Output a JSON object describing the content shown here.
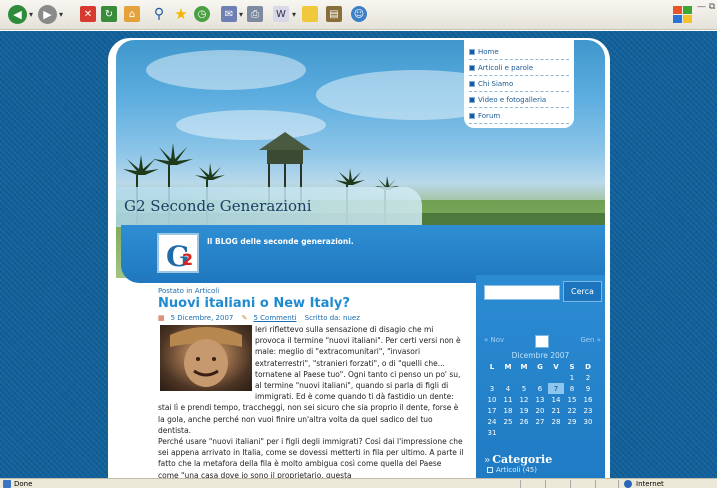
{
  "browser": {
    "toolbar_icons": [
      "back-icon",
      "forward-icon",
      "stop-icon",
      "refresh-icon",
      "home-icon",
      "search-icon",
      "favorites-icon",
      "history-icon",
      "mail-icon",
      "print-icon",
      "edit-icon",
      "folder-icon",
      "research-icon",
      "messenger-icon"
    ],
    "status_text": "Done",
    "zone_text": "Internet"
  },
  "nav": {
    "items": [
      {
        "label": "Home"
      },
      {
        "label": "Articoli e parole"
      },
      {
        "label": "Chi Siamo"
      },
      {
        "label": "Video e fotogalleria"
      },
      {
        "label": "Forum"
      }
    ]
  },
  "site": {
    "title": "G2 Seconde Generazioni",
    "tagline": "Il BLOG delle seconde generazioni.",
    "logo_letter": "G",
    "logo_number": "2"
  },
  "post": {
    "category_line": "Postato in Articoli",
    "title": "Nuovi italiani o New Italy?",
    "date": "5 Dicembre, 2007",
    "comments": "5 Commenti",
    "author": "Scritto da: nuez",
    "body_p1": "Ieri riflettevo sulla sensazione di disagio che mi provoca il termine \"nuovi italiani\". Per certi versi non è male: meglio di \"extracomunitari\", \"invasori extraterrestri\", \"stranieri forzati\", o di \"quelli che... tornatene al Paese tuo\". Ogni tanto ci penso un po' su, al termine \"nuovi italiani\", quando si parla di figli di immigrati. Ed è come quando ti dà fastidio un dente: stai lì e prendi tempo, traccheggi, non sei sicuro che sia proprio il dente, forse è la gola, anche perché non vuoi finire un'altra volta da quel sadico del tuo dentista.",
    "body_p2": "Perché usare \"nuovi italiani\" per i figli degli immigrati? Così dai l'impressione che sei appena arrivato in Italia, come se dovessi metterti in fila per ultimo. A parte il fatto che la metafora della fila è molto ambigua così come quella del Paese come \"una casa dove io sono il proprietario, questa"
  },
  "sidebar": {
    "search_button": "Cerca",
    "search_placeholder": "",
    "calendar": {
      "prev": "« Nov",
      "next": "Gen »",
      "month": "Dicembre 2007",
      "weekdays": [
        "L",
        "M",
        "M",
        "G",
        "V",
        "S",
        "D"
      ],
      "weeks": [
        [
          "",
          "",
          "",
          "",
          "",
          "1",
          "2"
        ],
        [
          "3",
          "4",
          "5",
          "6",
          "7",
          "8",
          "9"
        ],
        [
          "10",
          "11",
          "12",
          "13",
          "14",
          "15",
          "16"
        ],
        [
          "17",
          "18",
          "19",
          "20",
          "21",
          "22",
          "23"
        ],
        [
          "24",
          "25",
          "26",
          "27",
          "28",
          "29",
          "30"
        ],
        [
          "31",
          "",
          "",
          "",
          "",
          "",
          ""
        ]
      ],
      "today": "7"
    },
    "categories_heading": "Categorie",
    "category_item": "Articoli (45)"
  },
  "colors": {
    "accent": "#1f8bd1",
    "sidebar": "#2c8cd3",
    "logo_red": "#d6231f"
  }
}
